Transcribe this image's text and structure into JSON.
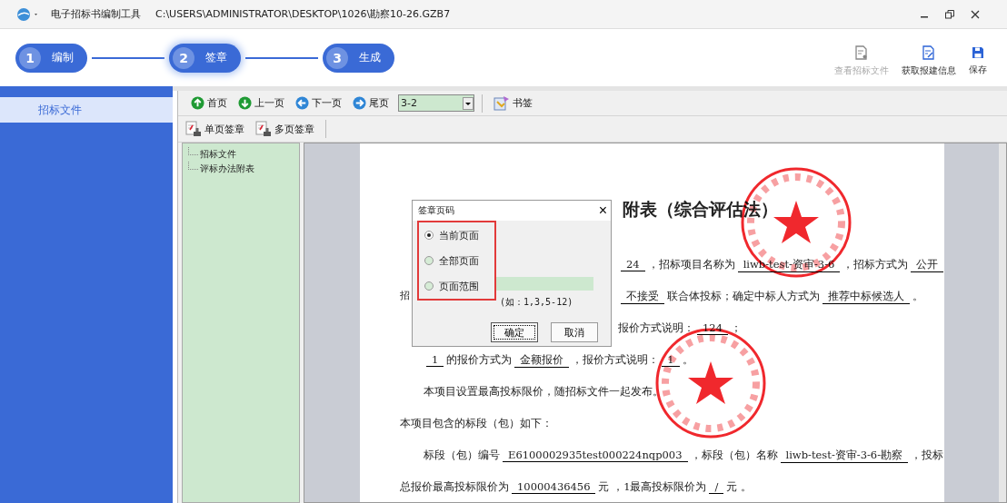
{
  "window": {
    "app_name": "电子招标书编制工具",
    "file_path": "C:\\USERS\\ADMINISTRATOR\\DESKTOP\\1026\\勘察10-26.GZB7"
  },
  "steps": [
    {
      "number": "1",
      "label": "编制",
      "selected": false
    },
    {
      "number": "2",
      "label": "签章",
      "selected": true
    },
    {
      "number": "3",
      "label": "生成",
      "selected": false
    }
  ],
  "actions": [
    {
      "label": "查看招标文件",
      "kind": "view",
      "disabled": true
    },
    {
      "label": "获取报建信息",
      "kind": "fetch",
      "disabled": false
    },
    {
      "label": "保存",
      "kind": "save",
      "disabled": false
    }
  ],
  "sidebar": {
    "items": [
      {
        "label": "招标文件",
        "selected": true
      }
    ]
  },
  "nav_toolbar": {
    "buttons": [
      {
        "label": "首页",
        "kind": "first"
      },
      {
        "label": "上一页",
        "kind": "prev"
      },
      {
        "label": "下一页",
        "kind": "next"
      },
      {
        "label": "尾页",
        "kind": "last"
      }
    ],
    "page_combo": "3-2",
    "bookmark": "书签"
  },
  "sign_toolbar": {
    "buttons": [
      {
        "label": "单页签章"
      },
      {
        "label": "多页签章"
      }
    ]
  },
  "tree": {
    "items": [
      {
        "label": "招标文件"
      },
      {
        "label": "评标办法附表"
      }
    ]
  },
  "document": {
    "title": "附表（综合评估法）",
    "lines": [
      {
        "kind": "covered",
        "segments": [
          {
            "text": "24",
            "underline": true
          },
          {
            "text": "，招标项目名称为",
            "underline": false
          },
          {
            "text": "liwb-test-资审-3-6",
            "underline": true
          },
          {
            "text": "，招标方式为",
            "underline": false
          },
          {
            "text": "公开",
            "underline": true
          }
        ]
      },
      {
        "kind": "covered",
        "lead": "招",
        "segments": [
          {
            "text": "不接受",
            "underline": true
          },
          {
            "text": "联合体投标；确定中标人方式为",
            "underline": false
          },
          {
            "text": "推荐中标候选人",
            "underline": true
          },
          {
            "text": "。",
            "underline": false
          }
        ]
      },
      {
        "kind": "covered",
        "segments": [
          {
            "text": "报价方式说明：",
            "underline": false
          },
          {
            "text": "124",
            "underline": true
          },
          {
            "text": "；",
            "underline": false
          }
        ]
      },
      {
        "kind": "indent",
        "segments": [
          {
            "text": "1",
            "underline": true
          },
          {
            "text": "的报价方式为",
            "underline": false
          },
          {
            "text": "金额报价",
            "underline": true
          },
          {
            "text": "，报价方式说明：",
            "underline": false
          },
          {
            "text": "1",
            "underline": true
          },
          {
            "text": "。",
            "underline": false
          }
        ]
      },
      {
        "kind": "indent",
        "segments": [
          {
            "text": "本项目设置最高投标限价，随招标文件一起发布。",
            "underline": false
          }
        ]
      },
      {
        "kind": "flush",
        "segments": [
          {
            "text": "本项目包含的标段（包）如下：",
            "underline": false
          }
        ]
      },
      {
        "kind": "indent",
        "segments": [
          {
            "text": "标段（包）编号",
            "underline": false
          },
          {
            "text": "E6100002935test000224nqp003",
            "underline": true
          },
          {
            "text": "，标段（包）名称",
            "underline": false
          },
          {
            "text": "liwb-test-资审-3-6-勘察",
            "underline": true
          },
          {
            "text": "，投标",
            "underline": false
          }
        ]
      },
      {
        "kind": "flush",
        "segments": [
          {
            "text": "总报价最高投标限价为",
            "underline": false
          },
          {
            "text": "10000436456",
            "underline": true
          },
          {
            "text": "元 ，1最高投标限价为",
            "underline": false
          },
          {
            "text": "/",
            "underline": true
          },
          {
            "text": "元 。",
            "underline": false
          }
        ]
      }
    ]
  },
  "dialog": {
    "title": "签章页码",
    "close": "×",
    "options": [
      {
        "label": "当前页面",
        "selected": true
      },
      {
        "label": "全部页面",
        "selected": false
      },
      {
        "label": "页面范围",
        "selected": false
      }
    ],
    "range_hint": "(如：1,3,5-12)",
    "ok": "确定",
    "cancel": "取消"
  }
}
